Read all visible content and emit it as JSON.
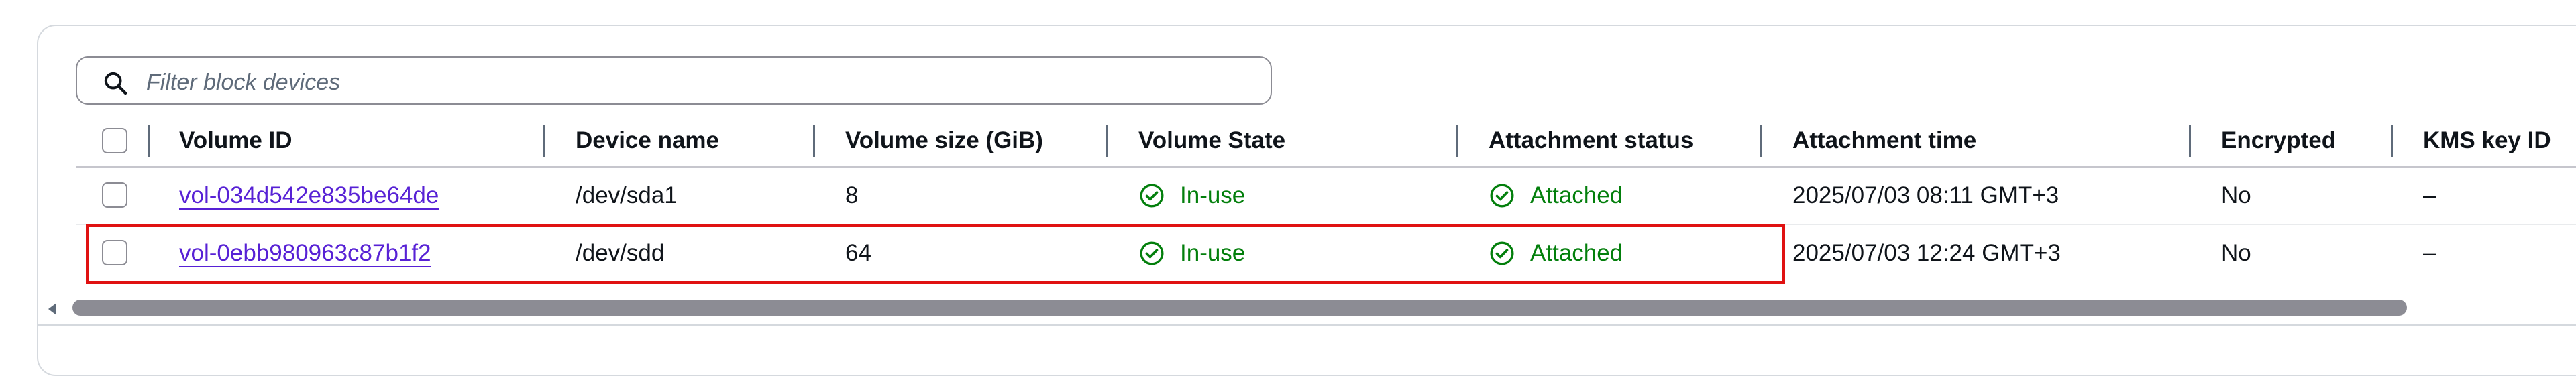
{
  "filter": {
    "placeholder": "Filter block devices",
    "icon": "search-icon"
  },
  "columns": [
    "Volume ID",
    "Device name",
    "Volume size (GiB)",
    "Volume State",
    "Attachment status",
    "Attachment time",
    "Encrypted",
    "KMS key ID"
  ],
  "rows": [
    {
      "volume_id": "vol-034d542e835be64de",
      "device_name": "/dev/sda1",
      "size": "8",
      "state": "In-use",
      "attachment_status": "Attached",
      "attachment_time": "2025/07/03 08:11 GMT+3",
      "encrypted": "No",
      "kms_key_id": "–",
      "highlighted": false
    },
    {
      "volume_id": "vol-0ebb980963c87b1f2",
      "device_name": "/dev/sdd",
      "size": "64",
      "state": "In-use",
      "attachment_status": "Attached",
      "attachment_time": "2025/07/03 12:24 GMT+3",
      "encrypted": "No",
      "kms_key_id": "–",
      "highlighted": true
    }
  ],
  "colors": {
    "link": "#5721d5",
    "success": "#037f0c",
    "highlight_border": "#e01111",
    "text": "#0f141a"
  },
  "icons": {
    "status": "check-circle-icon"
  }
}
